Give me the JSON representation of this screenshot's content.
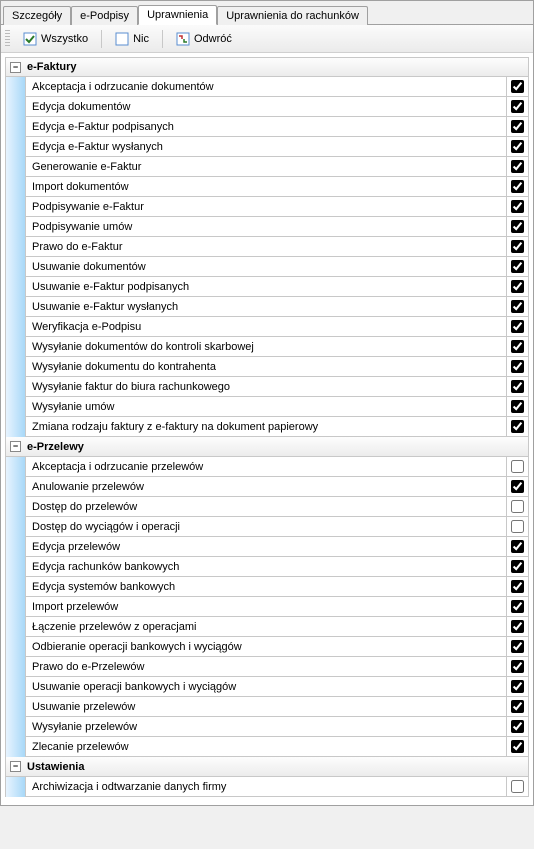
{
  "tabs": {
    "details": "Szczegóły",
    "esignatures": "e-Podpisy",
    "permissions": "Uprawnienia",
    "account_permissions": "Uprawnienia do rachunków"
  },
  "toolbar": {
    "all": "Wszystko",
    "none": "Nic",
    "invert": "Odwróć"
  },
  "groups": [
    {
      "title": "e-Faktury",
      "items": [
        {
          "label": "Akceptacja i odrzucanie dokumentów",
          "checked": true
        },
        {
          "label": "Edycja dokumentów",
          "checked": true
        },
        {
          "label": "Edycja e-Faktur podpisanych",
          "checked": true
        },
        {
          "label": "Edycja e-Faktur wysłanych",
          "checked": true
        },
        {
          "label": "Generowanie e-Faktur",
          "checked": true
        },
        {
          "label": "Import dokumentów",
          "checked": true
        },
        {
          "label": "Podpisywanie e-Faktur",
          "checked": true
        },
        {
          "label": "Podpisywanie umów",
          "checked": true
        },
        {
          "label": "Prawo do e-Faktur",
          "checked": true
        },
        {
          "label": "Usuwanie dokumentów",
          "checked": true
        },
        {
          "label": "Usuwanie e-Faktur podpisanych",
          "checked": true
        },
        {
          "label": "Usuwanie e-Faktur wysłanych",
          "checked": true
        },
        {
          "label": "Weryfikacja e-Podpisu",
          "checked": true
        },
        {
          "label": "Wysyłanie dokumentów do kontroli skarbowej",
          "checked": true
        },
        {
          "label": "Wysyłanie dokumentu do kontrahenta",
          "checked": true
        },
        {
          "label": "Wysyłanie faktur do biura rachunkowego",
          "checked": true
        },
        {
          "label": "Wysyłanie umów",
          "checked": true
        },
        {
          "label": "Zmiana rodzaju faktury z e-faktury na dokument papierowy",
          "checked": true
        }
      ]
    },
    {
      "title": "e-Przelewy",
      "items": [
        {
          "label": "Akceptacja i odrzucanie przelewów",
          "checked": false
        },
        {
          "label": "Anulowanie przelewów",
          "checked": true
        },
        {
          "label": "Dostęp do przelewów",
          "checked": false
        },
        {
          "label": "Dostęp do wyciągów i operacji",
          "checked": false
        },
        {
          "label": "Edycja przelewów",
          "checked": true
        },
        {
          "label": "Edycja rachunków bankowych",
          "checked": true
        },
        {
          "label": "Edycja systemów bankowych",
          "checked": true
        },
        {
          "label": "Import przelewów",
          "checked": true
        },
        {
          "label": "Łączenie przelewów z operacjami",
          "checked": true
        },
        {
          "label": "Odbieranie operacji bankowych i wyciągów",
          "checked": true
        },
        {
          "label": "Prawo do e-Przelewów",
          "checked": true
        },
        {
          "label": "Usuwanie operacji bankowych i wyciągów",
          "checked": true
        },
        {
          "label": "Usuwanie przelewów",
          "checked": true
        },
        {
          "label": "Wysyłanie przelewów",
          "checked": true
        },
        {
          "label": "Zlecanie przelewów",
          "checked": true
        }
      ]
    },
    {
      "title": "Ustawienia",
      "items": [
        {
          "label": "Archiwizacja i odtwarzanie danych firmy",
          "checked": false
        }
      ]
    }
  ]
}
